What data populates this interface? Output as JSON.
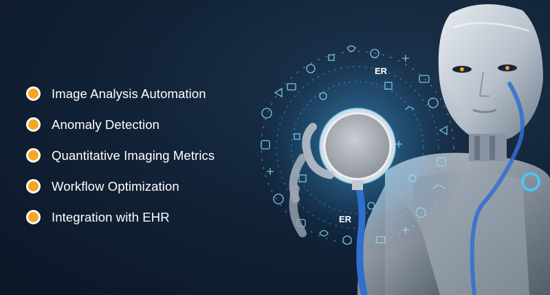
{
  "features": [
    {
      "label": "Image Analysis Automation"
    },
    {
      "label": "Anomaly Detection"
    },
    {
      "label": "Quantitative Imaging Metrics"
    },
    {
      "label": "Workflow Optimization"
    },
    {
      "label": "Integration with EHR"
    }
  ],
  "hologram_labels": [
    "ER",
    "ER"
  ],
  "colors": {
    "background": "#122338",
    "bullet_fill": "#f5a623",
    "bullet_ring": "#ffffff",
    "text": "#ffffff",
    "hologram_glow": "#5fd0ff",
    "stethoscope_tube": "#2f6fd0"
  },
  "icons": [
    "robot-doctor-illustration",
    "stethoscope-icon",
    "medical-icons-hologram"
  ]
}
